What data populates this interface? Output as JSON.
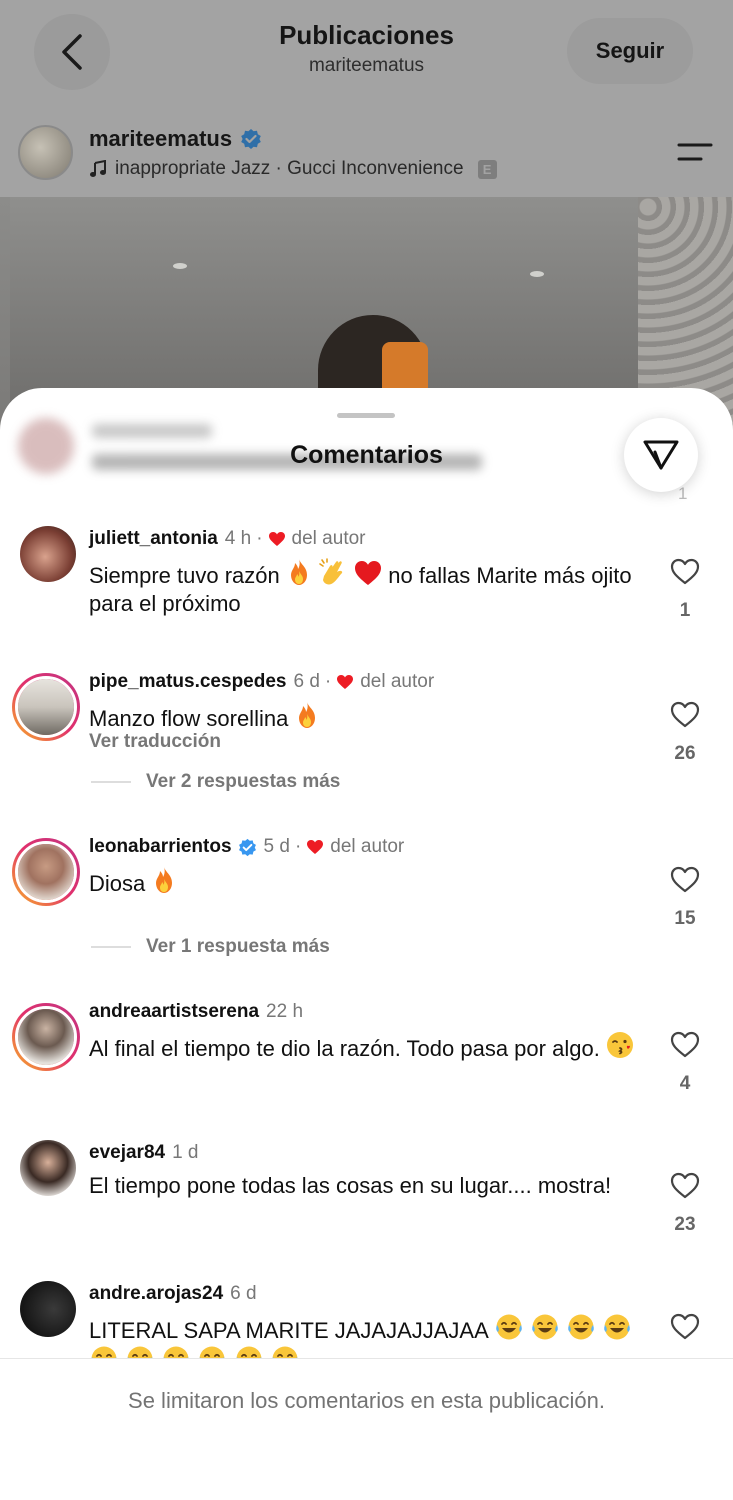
{
  "header": {
    "title": "Publicaciones",
    "subtitle": "mariteematus",
    "follow_label": "Seguir"
  },
  "post": {
    "username": "mariteematus",
    "music": "inappropriate Jazz · Gucci Inconvenience",
    "explicit_badge": "E"
  },
  "sheet": {
    "title": "Comentarios",
    "hidden_count": "1"
  },
  "comments": [
    {
      "username": "juliett_antonia",
      "time": "4 h",
      "author_liked": "del autor",
      "text": "Siempre tuvo razón",
      "text_tail": "no fallas Marite más ojito para el próximo",
      "likes": "1"
    },
    {
      "username": "pipe_matus.cespedes",
      "time": "6 d",
      "author_liked": "del autor",
      "text": "Manzo flow sorellina",
      "translate": "Ver traducción",
      "likes": "26",
      "replies": "Ver 2 respuestas más"
    },
    {
      "username": "leonabarrientos",
      "time": "5 d",
      "author_liked": "del autor",
      "text": "Diosa",
      "likes": "15",
      "replies": "Ver 1 respuesta más"
    },
    {
      "username": "andreaartistserena",
      "time": "22 h",
      "text": "Al final el tiempo te dio la razón.  Todo pasa por algo.",
      "likes": "4"
    },
    {
      "username": "evejar84",
      "time": "1 d",
      "text": "El tiempo pone todas las cosas en su lugar.... mostra!",
      "likes": "23"
    },
    {
      "username": "andre.arojas24",
      "time": "6 d",
      "text": "LITERAL SAPA MARITE JAJAJAJJAJAA"
    }
  ],
  "footer": {
    "notice": "Se limitaron los comentarios en esta publicación."
  },
  "colors": {
    "verified": "#3897f0",
    "heart": "#ed1c24",
    "dim_overlay": "#9a9a9a"
  }
}
